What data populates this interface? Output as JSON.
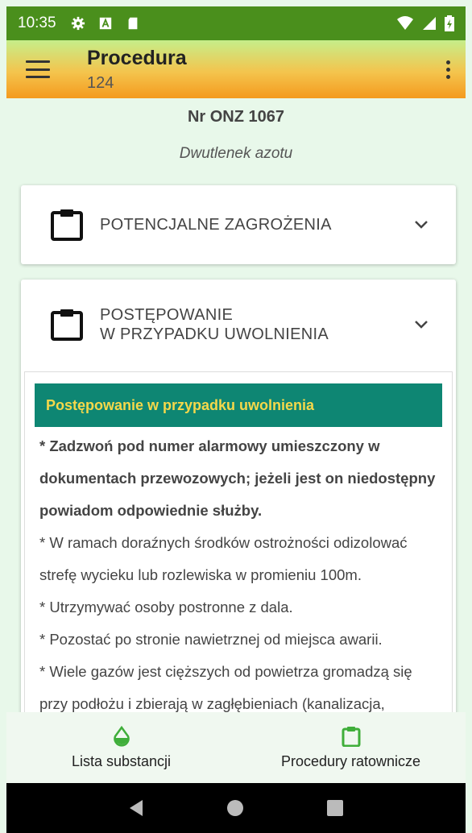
{
  "status_bar": {
    "time": "10:35",
    "icons": [
      "gear-icon",
      "a-icon",
      "sd-card-icon",
      "wifi-icon",
      "signal-icon",
      "battery-icon"
    ]
  },
  "app_bar": {
    "title": "Procedura",
    "subtitle": "124",
    "gradient": [
      "#c6ee8a",
      "#f4c44d",
      "#f49a1e"
    ]
  },
  "header": {
    "onz": "Nr ONZ 1067",
    "substance": "Dwutlenek azotu"
  },
  "sections": [
    {
      "title": "POTENCJALNE ZAGROŻENIA",
      "expanded": false
    },
    {
      "title_line1": "POSTĘPOWANIE",
      "title_line2": "W PRZYPADKU UWOLNIENIA",
      "expanded": true
    }
  ],
  "panel": {
    "heading": "Postępowanie w przypadku uwolnienia",
    "bold_lead": "* Zadzwoń pod numer alarmowy umieszczony w dokumentach przewozowych; jeżeli jest on niedostępny powiadom odpowiednie służby.",
    "lines": [
      "* W ramach doraźnych środków ostrożności odizolować strefę wycieku lub rozlewiska w promieniu 100m.",
      "* Utrzymywać osoby postronne z dala.",
      "* Pozostać po stronie nawietrznej od miejsca awarii.",
      "* Wiele gazów jest cięższych od powietrza gromadzą się przy podłożu i zbierają w zagłębieniach (kanalizacja,"
    ],
    "heading_bg": "#0e8673",
    "heading_color": "#f5d84a"
  },
  "bottom_nav": [
    {
      "label": "Lista substancji",
      "icon": "drop-icon"
    },
    {
      "label": "Procedury ratownicze",
      "icon": "clipboard-icon"
    }
  ],
  "accent": "#3fae3a"
}
